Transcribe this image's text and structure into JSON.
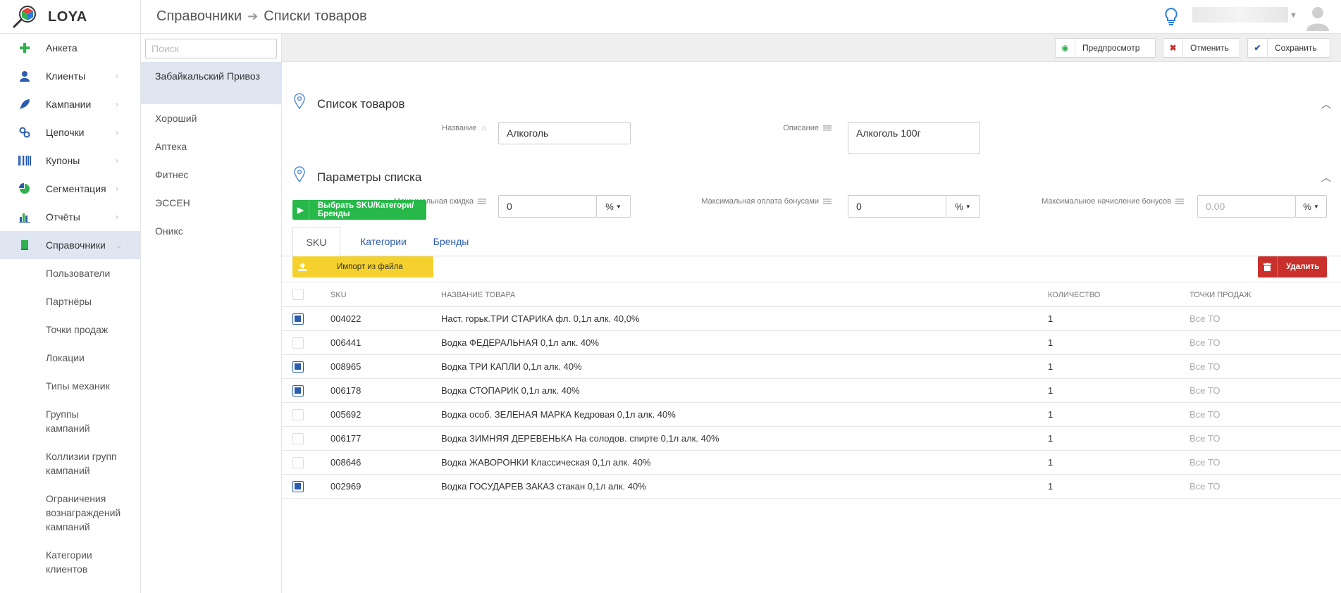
{
  "app": {
    "name": "LOYA",
    "breadcrumb": [
      "Справочники",
      "Списки товаров"
    ]
  },
  "sidebar": {
    "items": [
      {
        "label": "Анкета",
        "icon": "plus-icon",
        "chevron": false
      },
      {
        "label": "Клиенты",
        "icon": "user-icon",
        "chevron": true
      },
      {
        "label": "Кампании",
        "icon": "rocket-icon",
        "chevron": true
      },
      {
        "label": "Цепочки",
        "icon": "chain-icon",
        "chevron": true
      },
      {
        "label": "Купоны",
        "icon": "barcode-icon",
        "chevron": true
      },
      {
        "label": "Сегментация",
        "icon": "pie-chart-icon",
        "chevron": true
      },
      {
        "label": "Отчёты",
        "icon": "bar-chart-icon",
        "chevron": true
      },
      {
        "label": "Справочники",
        "icon": "book-icon",
        "chevron": true,
        "active": true
      }
    ],
    "subitems": [
      "Пользователи",
      "Партнёры",
      "Точки продаж",
      "Локации",
      "Типы механик",
      "Группы кампаний",
      "Коллизии групп кампаний",
      "Ограничения вознаграждений кампаний",
      "Категории клиентов"
    ]
  },
  "list_panel": {
    "search_placeholder": "Поиск",
    "items": [
      "Забайкальский Привоз",
      "Хороший",
      "Аптека",
      "Фитнес",
      "ЭССЕН",
      "Оникс"
    ]
  },
  "toolbar": {
    "preview_label": "Предпросмотр",
    "cancel_label": "Отменить",
    "save_label": "Сохранить"
  },
  "section_list": {
    "title": "Список товаров",
    "name_label": "Название",
    "name_value": "Алкоголь",
    "desc_label": "Описание",
    "desc_value": "Алкоголь 100г"
  },
  "section_params": {
    "title": "Параметры списка",
    "max_discount_label": "Максимальная скидка",
    "max_discount_value": "0",
    "max_discount_unit": "%",
    "max_bonus_pay_label": "Максимальная оплата бонусами",
    "max_bonus_pay_value": "0",
    "max_bonus_pay_unit": "%",
    "max_bonus_accrual_label": "Максимальное начисление бонусов",
    "max_bonus_accrual_placeholder": "0.00",
    "max_bonus_accrual_unit": "%"
  },
  "select_button_label": "Выбрать SKU/Категори/Бренды",
  "tabs": [
    "SKU",
    "Категории",
    "Бренды"
  ],
  "import_label": "Импорт из файла",
  "delete_label": "Удалить",
  "colors": {
    "accent_blue": "#2a5db0",
    "green": "#27b84a",
    "yellow": "#f5d12e",
    "red": "#c9302c",
    "active_bg": "#dfe5f1"
  },
  "table": {
    "headers": [
      "SKU",
      "Название товара",
      "Количество",
      "Точки продаж"
    ],
    "rows": [
      {
        "checked": true,
        "sku": "004022",
        "name": "Наст. горьк.ТРИ СТАРИКА фл. 0,1л алк. 40,0%",
        "qty": "1",
        "points": "Все ТО"
      },
      {
        "checked": false,
        "sku": "006441",
        "name": "Водка ФЕДЕРАЛЬНАЯ 0,1л алк. 40%",
        "qty": "1",
        "points": "Все ТО"
      },
      {
        "checked": true,
        "sku": "008965",
        "name": "Водка ТРИ КАПЛИ 0,1л алк. 40%",
        "qty": "1",
        "points": "Все ТО"
      },
      {
        "checked": true,
        "sku": "006178",
        "name": "Водка СТОПАРИК 0,1л алк. 40%",
        "qty": "1",
        "points": "Все ТО"
      },
      {
        "checked": false,
        "sku": "005692",
        "name": "Водка особ. ЗЕЛЕНАЯ МАРКА Кедровая 0,1л алк. 40%",
        "qty": "1",
        "points": "Все ТО"
      },
      {
        "checked": false,
        "sku": "006177",
        "name": "Водка ЗИМНЯЯ ДЕРЕВЕНЬКА На солодов. спирте 0,1л алк. 40%",
        "qty": "1",
        "points": "Все ТО"
      },
      {
        "checked": false,
        "sku": "008646",
        "name": "Водка ЖАВОРОНКИ Классическая 0,1л алк. 40%",
        "qty": "1",
        "points": "Все ТО"
      },
      {
        "checked": true,
        "sku": "002969",
        "name": "Водка ГОСУДАРЕВ ЗАКАЗ стакан 0,1л алк. 40%",
        "qty": "1",
        "points": "Все ТО"
      }
    ]
  }
}
